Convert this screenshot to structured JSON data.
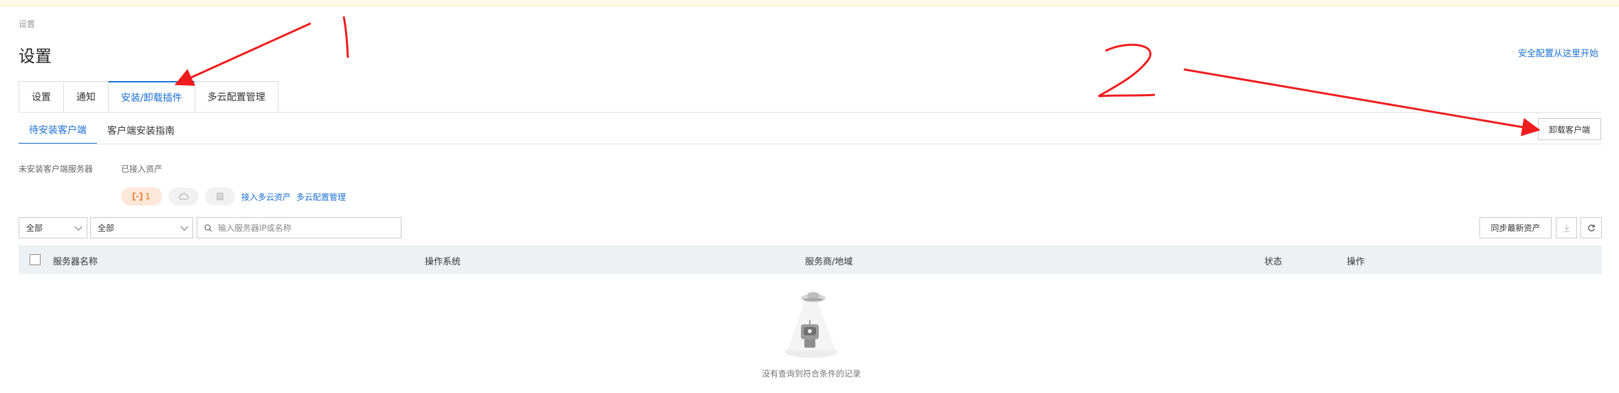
{
  "breadcrumb": "设置",
  "page_title": "设置",
  "top_link": "安全配置从这里开始",
  "tabs": [
    {
      "label": "设置"
    },
    {
      "label": "通知"
    },
    {
      "label": "安装/卸载插件",
      "active": true
    },
    {
      "label": "多云配置管理"
    }
  ],
  "subtabs": [
    {
      "label": "待安装客户端",
      "active": true
    },
    {
      "label": "客户端安装指南"
    }
  ],
  "uninstall_button": "卸载客户端",
  "stats": {
    "uninstalled_label": "未安装客户端服务器",
    "connected_label": "已接入资产",
    "count": "1",
    "connect_multicloud_link": "接入多云资产",
    "multicloud_manage_link": "多云配置管理"
  },
  "filters": {
    "select1": "全部",
    "select2": "全部",
    "search_placeholder": "输入服务器IP或名称"
  },
  "sync_button": "同步最新资产",
  "table": {
    "columns": [
      "服务器名称",
      "操作系统",
      "服务商/地域",
      "状态",
      "操作"
    ]
  },
  "empty_text": "没有查询到符合条件的记录",
  "annotations": {
    "mark1": "1",
    "mark2": "2",
    "color": "#ee1c1c"
  }
}
